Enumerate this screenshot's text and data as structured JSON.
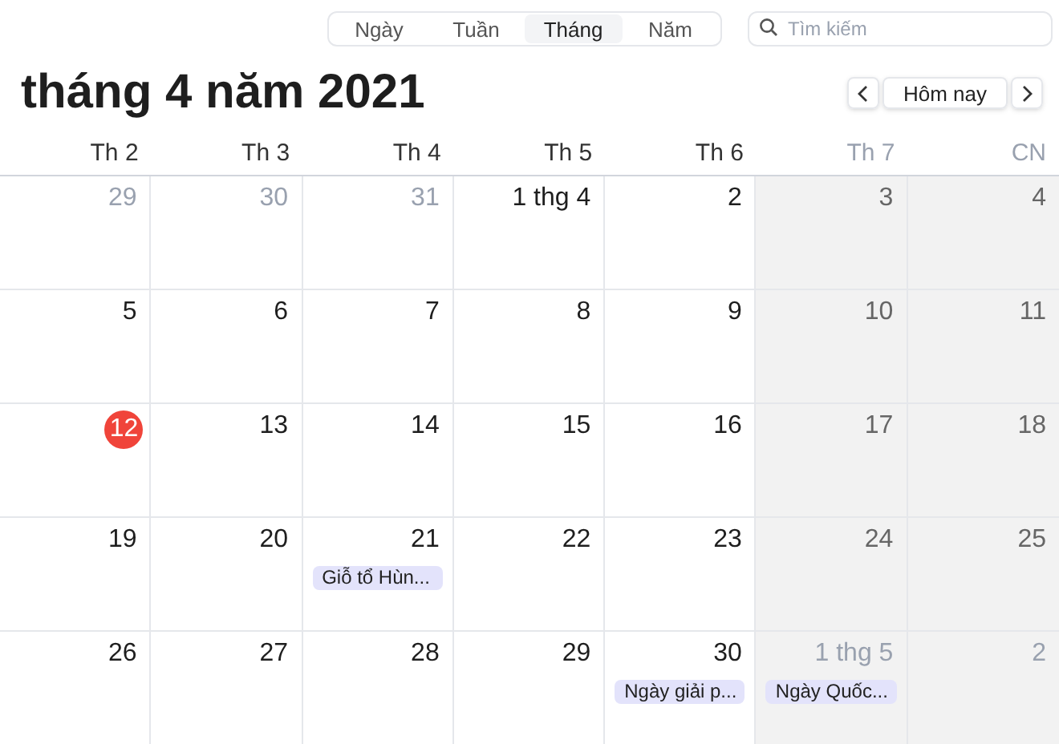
{
  "view_switcher": [
    {
      "label": "Ngày",
      "selected": false
    },
    {
      "label": "Tuần",
      "selected": false
    },
    {
      "label": "Tháng",
      "selected": true
    },
    {
      "label": "Năm",
      "selected": false
    }
  ],
  "search": {
    "placeholder": "Tìm kiếm"
  },
  "title": "tháng 4 năm 2021",
  "today_button": "Hôm nay",
  "weekdays": [
    {
      "label": "Th 2",
      "weekend": false
    },
    {
      "label": "Th 3",
      "weekend": false
    },
    {
      "label": "Th 4",
      "weekend": false
    },
    {
      "label": "Th 5",
      "weekend": false
    },
    {
      "label": "Th 6",
      "weekend": false
    },
    {
      "label": "Th 7",
      "weekend": true
    },
    {
      "label": "CN",
      "weekend": true
    }
  ],
  "weeks": [
    [
      {
        "day": "29",
        "in_month": false
      },
      {
        "day": "30",
        "in_month": false
      },
      {
        "day": "31",
        "in_month": false
      },
      {
        "day": "1 thg 4",
        "in_month": true
      },
      {
        "day": "2",
        "in_month": true
      },
      {
        "day": "3",
        "in_month": true
      },
      {
        "day": "4",
        "in_month": true
      }
    ],
    [
      {
        "day": "5",
        "in_month": true
      },
      {
        "day": "6",
        "in_month": true
      },
      {
        "day": "7",
        "in_month": true
      },
      {
        "day": "8",
        "in_month": true
      },
      {
        "day": "9",
        "in_month": true
      },
      {
        "day": "10",
        "in_month": true
      },
      {
        "day": "11",
        "in_month": true
      }
    ],
    [
      {
        "day": "12",
        "in_month": true,
        "today": true
      },
      {
        "day": "13",
        "in_month": true
      },
      {
        "day": "14",
        "in_month": true
      },
      {
        "day": "15",
        "in_month": true
      },
      {
        "day": "16",
        "in_month": true
      },
      {
        "day": "17",
        "in_month": true
      },
      {
        "day": "18",
        "in_month": true
      }
    ],
    [
      {
        "day": "19",
        "in_month": true
      },
      {
        "day": "20",
        "in_month": true
      },
      {
        "day": "21",
        "in_month": true,
        "events": [
          "Giỗ tổ Hùn..."
        ]
      },
      {
        "day": "22",
        "in_month": true
      },
      {
        "day": "23",
        "in_month": true
      },
      {
        "day": "24",
        "in_month": true
      },
      {
        "day": "25",
        "in_month": true
      }
    ],
    [
      {
        "day": "26",
        "in_month": true
      },
      {
        "day": "27",
        "in_month": true
      },
      {
        "day": "28",
        "in_month": true
      },
      {
        "day": "29",
        "in_month": true
      },
      {
        "day": "30",
        "in_month": true,
        "events": [
          "Ngày giải p..."
        ]
      },
      {
        "day": "1 thg 5",
        "in_month": false,
        "events": [
          "Ngày Quốc..."
        ]
      },
      {
        "day": "2",
        "in_month": false
      }
    ]
  ]
}
